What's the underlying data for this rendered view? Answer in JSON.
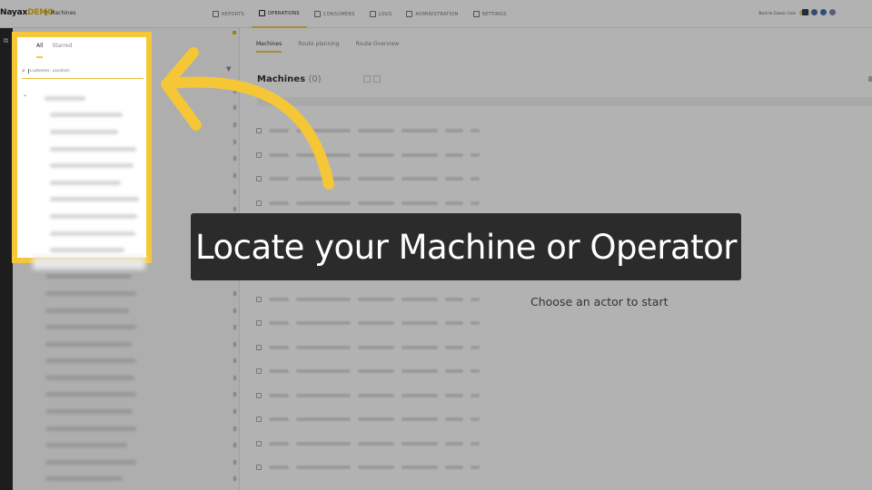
{
  "app": {
    "logo_text": "Nayax",
    "logo_demo": "DEMO",
    "breadcrumb": "Machines"
  },
  "nav": {
    "items": [
      {
        "label": "REPORTS",
        "icon": "reports-icon",
        "active": false
      },
      {
        "label": "OPERATIONS",
        "icon": "operations-icon",
        "active": true
      },
      {
        "label": "CONSUMERS",
        "icon": "consumers-icon",
        "active": false
      },
      {
        "label": "LOGS",
        "icon": "logs-icon",
        "active": false
      },
      {
        "label": "ADMINISTRATION",
        "icon": "administration-icon",
        "active": false
      },
      {
        "label": "SETTINGS",
        "icon": "settings-icon",
        "active": false
      }
    ]
  },
  "topright": {
    "toggle_label": "Back to Classic Core"
  },
  "subtabs": [
    "Machines",
    "Route planning",
    "Route Overview"
  ],
  "main": {
    "title": "Machines",
    "count": "(0)",
    "empty_message": "Choose an actor to start"
  },
  "search_panel": {
    "tabs": [
      "All",
      "Starred"
    ],
    "placeholder": "Customer, Location"
  },
  "caption": "Locate your Machine or Operator",
  "colors": {
    "accent": "#f5c737",
    "overlay": "rgba(0,0,0,0.30)",
    "caption_bg": "#2b2b2b"
  }
}
